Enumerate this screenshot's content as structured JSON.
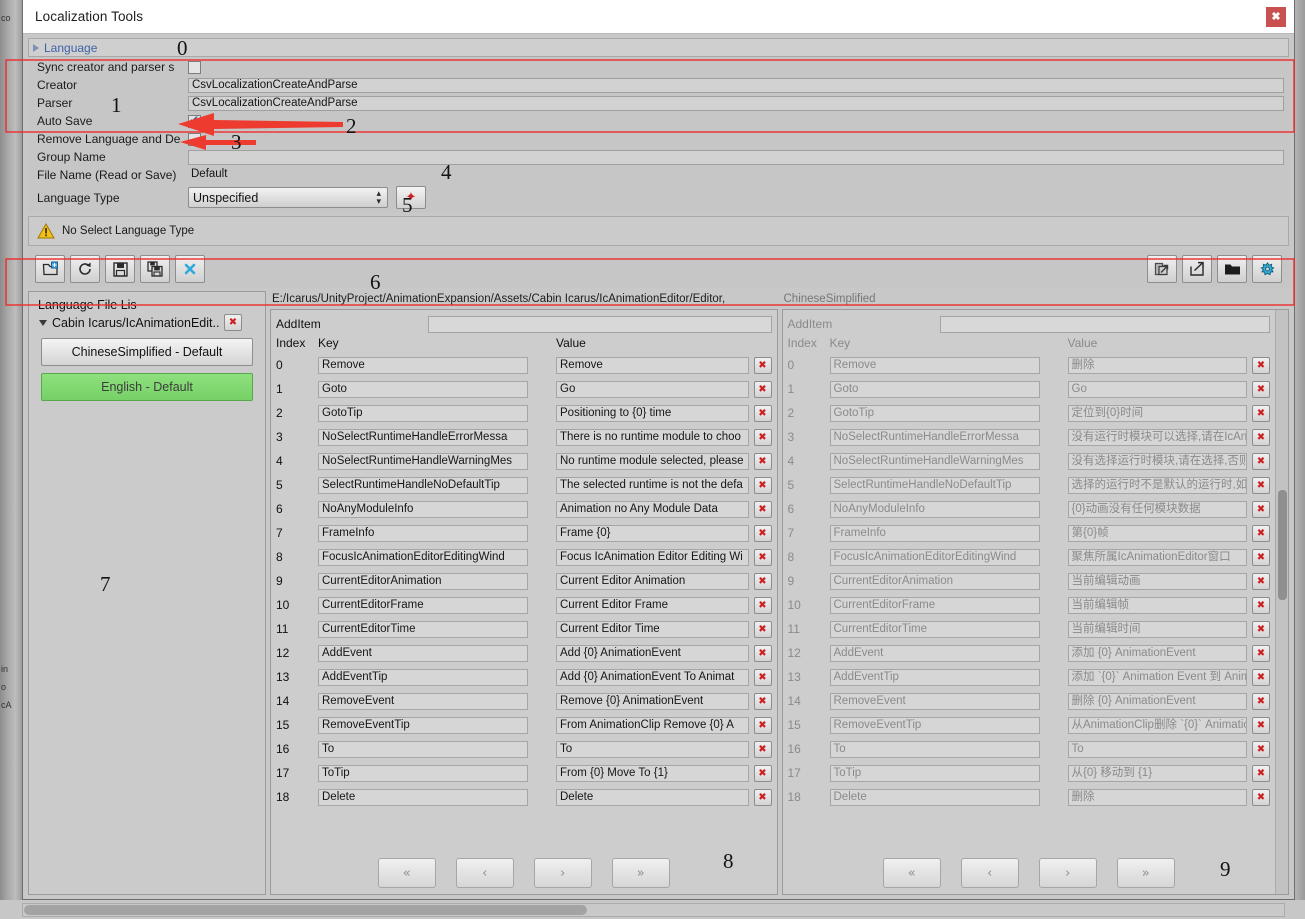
{
  "window": {
    "title": "Localization Tools",
    "close_label": "✖"
  },
  "foldout": {
    "label": "Language",
    "arrow": "triangle-right-icon"
  },
  "settings": {
    "sync_label": "Sync creator and parser s",
    "sync_checked": false,
    "creator_label": "Creator",
    "creator_value": "CsvLocalizationCreateAndParse",
    "parser_label": "Parser",
    "parser_value": "CsvLocalizationCreateAndParse",
    "autosave_label": "Auto Save",
    "autosave_checked": true,
    "remove_label": "Remove Language and De",
    "remove_checked": false,
    "group_label": "Group Name",
    "group_value": "",
    "filename_label": "File Name (Read or Save)",
    "filename_value": "Default",
    "langtype_label": "Language Type",
    "langtype_value": "Unspecified",
    "add_langtype_label": "✦"
  },
  "helpbox": {
    "icon": "warning-icon",
    "text": "No Select Language Type"
  },
  "toolbar": {
    "left": [
      {
        "name": "new-file-icon",
        "title": "New"
      },
      {
        "name": "refresh-icon",
        "title": "Refresh"
      },
      {
        "name": "save-icon",
        "title": "Save"
      },
      {
        "name": "save-all-icon",
        "title": "Save All"
      },
      {
        "name": "close-x-icon",
        "title": "Close"
      }
    ],
    "right": [
      {
        "name": "import-icon",
        "title": "Import"
      },
      {
        "name": "export-icon",
        "title": "Export"
      },
      {
        "name": "folder-icon",
        "title": "Open Folder"
      },
      {
        "name": "settings-gear-icon",
        "title": "Settings"
      }
    ]
  },
  "file_list": {
    "header": "Language File Lis",
    "tree_node": "Cabin Icarus/IcAnimationEdit...",
    "tree_remove_label": "✖",
    "languages": [
      {
        "label": "ChineseSimplified - Default",
        "selected": false
      },
      {
        "label": "English - Default",
        "selected": true
      }
    ]
  },
  "english_pane": {
    "path": "E:/Icarus/UnityProject/AnimationExpansion/Assets/Cabin Icarus/IcAnimationEditor/Editor,",
    "additem_label": "AddItem",
    "additem_value": "",
    "columns": {
      "index": "Index",
      "key": "Key",
      "value": "Value"
    },
    "remove_label": "✖",
    "rows": [
      {
        "index": "0",
        "key": "Remove",
        "value": "Remove"
      },
      {
        "index": "1",
        "key": "Goto",
        "value": "Go"
      },
      {
        "index": "2",
        "key": "GotoTip",
        "value": "Positioning to {0} time"
      },
      {
        "index": "3",
        "key": "NoSelectRuntimeHandleErrorMessa",
        "value": "There is no runtime module to choo"
      },
      {
        "index": "4",
        "key": "NoSelectRuntimeHandleWarningMes",
        "value": "No runtime module selected, please"
      },
      {
        "index": "5",
        "key": "SelectRuntimeHandleNoDefaultTip",
        "value": "The selected runtime is not the defa"
      },
      {
        "index": "6",
        "key": "NoAnyModuleInfo",
        "value": "Animation no Any Module Data"
      },
      {
        "index": "7",
        "key": "FrameInfo",
        "value": "Frame {0}"
      },
      {
        "index": "8",
        "key": "FocusIcAnimationEditorEditingWind",
        "value": "Focus IcAnimation Editor Editing Wi"
      },
      {
        "index": "9",
        "key": "CurrentEditorAnimation",
        "value": "Current Editor Animation"
      },
      {
        "index": "10",
        "key": "CurrentEditorFrame",
        "value": "Current Editor Frame"
      },
      {
        "index": "11",
        "key": "CurrentEditorTime",
        "value": "Current Editor Time"
      },
      {
        "index": "12",
        "key": "AddEvent",
        "value": "Add {0} AnimationEvent"
      },
      {
        "index": "13",
        "key": "AddEventTip",
        "value": "Add {0} AnimationEvent To Animat"
      },
      {
        "index": "14",
        "key": "RemoveEvent",
        "value": "Remove {0} AnimationEvent"
      },
      {
        "index": "15",
        "key": "RemoveEventTip",
        "value": "From AnimationClip Remove {0} A"
      },
      {
        "index": "16",
        "key": "To",
        "value": "To"
      },
      {
        "index": "17",
        "key": "ToTip",
        "value": "From {0} Move To {1}"
      },
      {
        "index": "18",
        "key": "Delete",
        "value": "Delete"
      }
    ],
    "pager": [
      "«",
      "‹",
      "›",
      "»"
    ]
  },
  "chinese_pane": {
    "path": "ChineseSimplified",
    "additem_label": "AddItem",
    "additem_value": "",
    "columns": {
      "index": "Index",
      "key": "Key",
      "value": "Value"
    },
    "remove_label": "✖",
    "rows": [
      {
        "index": "0",
        "key": "Remove",
        "value": "删除"
      },
      {
        "index": "1",
        "key": "Goto",
        "value": "Go"
      },
      {
        "index": "2",
        "key": "GotoTip",
        "value": "定位到{0}时间"
      },
      {
        "index": "3",
        "key": "NoSelectRuntimeHandleErrorMessa",
        "value": "没有运行时模块可以选择,请在IcAnimati"
      },
      {
        "index": "4",
        "key": "NoSelectRuntimeHandleWarningMes",
        "value": "没有选择运行时模块,请在选择,否则不会补"
      },
      {
        "index": "5",
        "key": "SelectRuntimeHandleNoDefaultTip",
        "value": "选择的运行时不是默认的运行时,如果是可"
      },
      {
        "index": "6",
        "key": "NoAnyModuleInfo",
        "value": "{0}动画没有任何模块数据"
      },
      {
        "index": "7",
        "key": "FrameInfo",
        "value": "第{0}帧"
      },
      {
        "index": "8",
        "key": "FocusIcAnimationEditorEditingWind",
        "value": "聚焦所属IcAnimationEditor窗口"
      },
      {
        "index": "9",
        "key": "CurrentEditorAnimation",
        "value": "当前编辑动画"
      },
      {
        "index": "10",
        "key": "CurrentEditorFrame",
        "value": "当前编辑帧"
      },
      {
        "index": "11",
        "key": "CurrentEditorTime",
        "value": "当前编辑时间"
      },
      {
        "index": "12",
        "key": "AddEvent",
        "value": "添加 {0} AnimationEvent"
      },
      {
        "index": "13",
        "key": "AddEventTip",
        "value": "添加 `{0}` Animation Event 到 Anim"
      },
      {
        "index": "14",
        "key": "RemoveEvent",
        "value": "删除 {0} AnimationEvent"
      },
      {
        "index": "15",
        "key": "RemoveEventTip",
        "value": "从AnimationClip删除 `{0}` Animatio"
      },
      {
        "index": "16",
        "key": "To",
        "value": "To"
      },
      {
        "index": "17",
        "key": "ToTip",
        "value": "从{0} 移动到 {1}"
      },
      {
        "index": "18",
        "key": "Delete",
        "value": "删除"
      }
    ],
    "pager": [
      "«",
      "‹",
      "›",
      "»"
    ]
  },
  "annotations": {
    "numbers": [
      "0",
      "1",
      "2",
      "3",
      "4",
      "5",
      "6",
      "7",
      "8",
      "9"
    ],
    "accent_color": "#ee2b2b"
  },
  "background_text": [
    "co",
    "in",
    "o",
    "cA"
  ]
}
